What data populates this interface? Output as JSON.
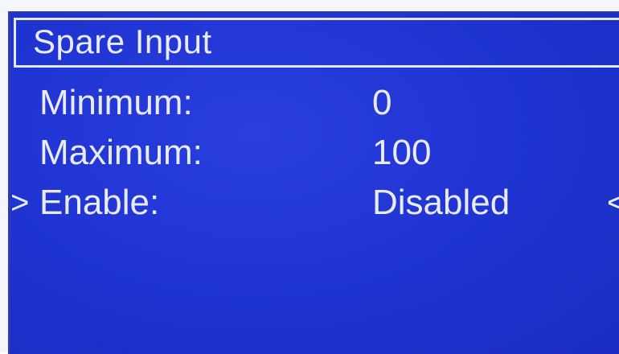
{
  "screen": {
    "title": "Spare Input",
    "rows": [
      {
        "label": "Minimum:",
        "value": "0"
      },
      {
        "label": "Maximum:",
        "value": "100"
      },
      {
        "label": "Enable:",
        "value": "Disabled"
      }
    ],
    "selection": {
      "left_marker": ">",
      "right_marker": "<"
    }
  },
  "colors": {
    "screen_background": "#1e33d0",
    "text": "#e9ecf8"
  }
}
